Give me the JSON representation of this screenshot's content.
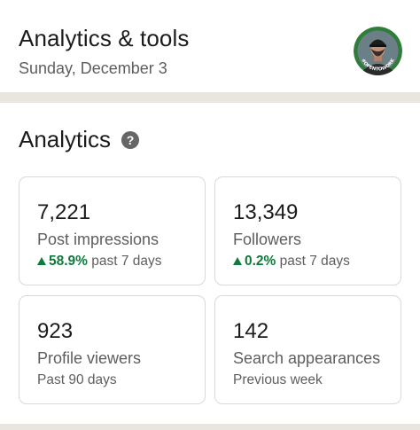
{
  "header": {
    "title": "Analytics & tools",
    "date": "Sunday, December 3",
    "avatar_badge": "#OPENTOWORK"
  },
  "analytics": {
    "title": "Analytics",
    "help_icon": "question-circle-icon",
    "cards": [
      {
        "value": "7,221",
        "label": "Post impressions",
        "trend": "58.9%",
        "period": "past 7 days",
        "trend_direction": "up"
      },
      {
        "value": "13,349",
        "label": "Followers",
        "trend": "0.2%",
        "period": "past 7 days",
        "trend_direction": "up"
      },
      {
        "value": "923",
        "label": "Profile viewers",
        "period": "Past 90 days"
      },
      {
        "value": "142",
        "label": "Search appearances",
        "period": "Previous week"
      }
    ]
  },
  "colors": {
    "trend_up": "#0f7a3c",
    "open_to_work_ring": "#2f7d3a"
  }
}
